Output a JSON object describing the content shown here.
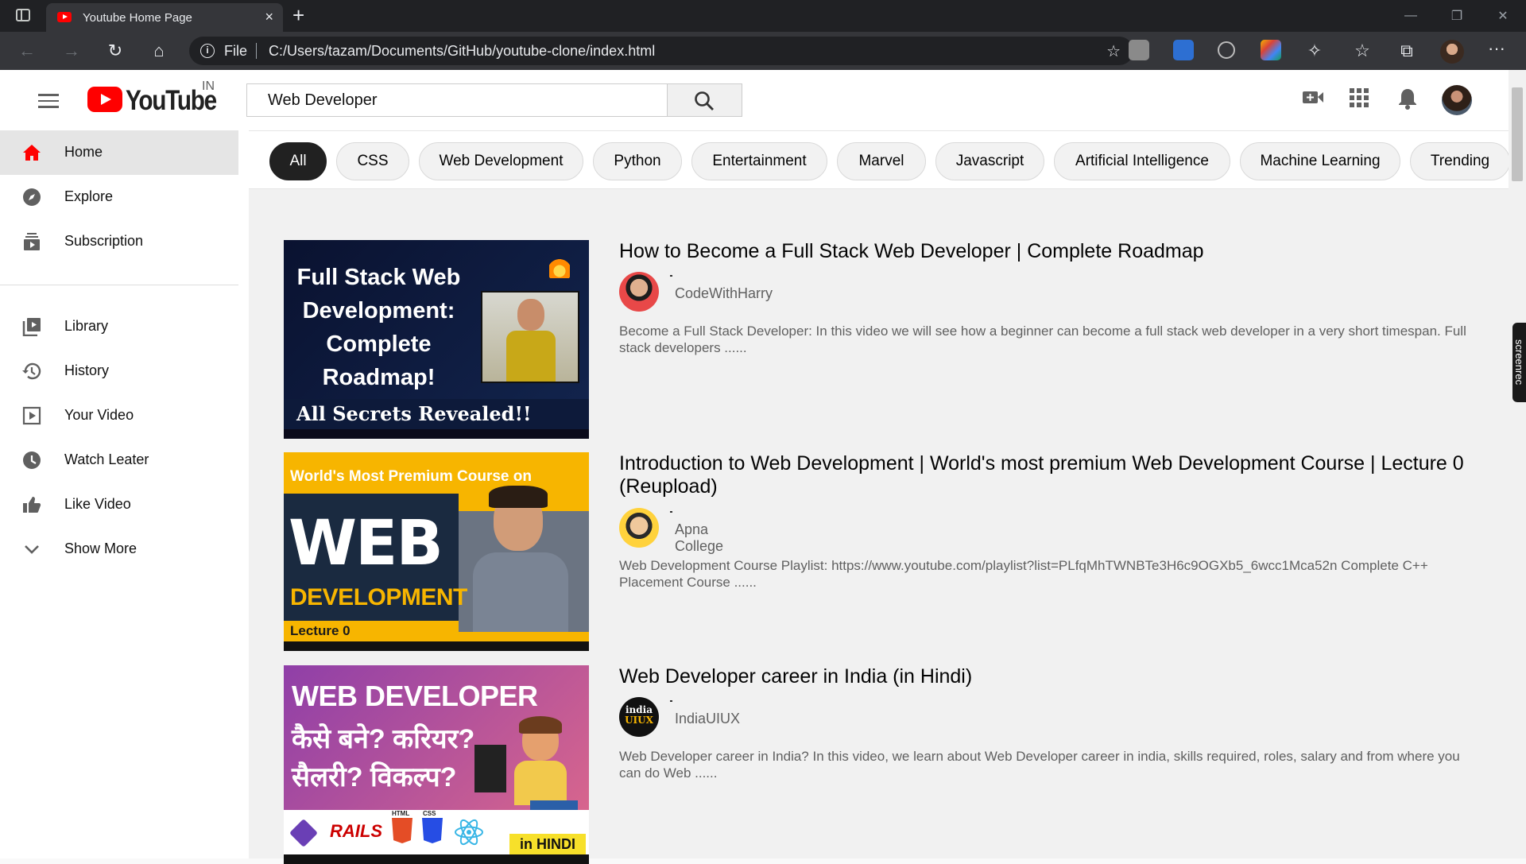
{
  "browser": {
    "tab_title": "Youtube Home Page",
    "close_tab": "×",
    "new_tab": "+",
    "address_scheme": "File",
    "address_url": "C:/Users/tazam/Documents/GitHub/youtube-clone/index.html",
    "min": "—",
    "max": "❐",
    "close": "✕",
    "more": "···"
  },
  "header": {
    "logo_text": "YouTube",
    "country_code": "IN",
    "search_value": "Web Developer"
  },
  "sidebar": {
    "items": [
      {
        "label": "Home",
        "icon": "home-icon"
      },
      {
        "label": "Explore",
        "icon": "compass-icon"
      },
      {
        "label": "Subscription",
        "icon": "subscriptions-icon"
      },
      {
        "label": "Library",
        "icon": "library-icon"
      },
      {
        "label": "History",
        "icon": "history-icon"
      },
      {
        "label": "Your Video",
        "icon": "play-icon"
      },
      {
        "label": "Watch Leater",
        "icon": "clock-icon"
      },
      {
        "label": "Like Video",
        "icon": "thumbs-up-icon"
      },
      {
        "label": "Show More",
        "icon": "chevron-down-icon"
      }
    ]
  },
  "chips": [
    "All",
    "CSS",
    "Web Development",
    "Python",
    "Entertainment",
    "Marvel",
    "Javascript",
    "Artificial Intelligence",
    "Machine Learning",
    "Trending"
  ],
  "videos": [
    {
      "title": "How to Become a Full Stack Web Developer | Complete Roadmap",
      "channel": "CodeWithHarry",
      "description": "Become a Full Stack Developer: In this video we will see how a beginner can become a full stack web developer in a very short timespan. Full stack developers ......",
      "thumb_lines": [
        "Full Stack Web",
        "Development:",
        "Complete",
        "Roadmap!"
      ],
      "thumb_banner": "All Secrets Revealed!!"
    },
    {
      "title": "Introduction to Web Development | World's most premium Web Development Course | Lecture 0 (Reupload)",
      "channel": "Apna College",
      "description": "Web Development Course Playlist: https://www.youtube.com/playlist?list=PLfqMhTWNBTe3H6c9OGXb5_6wcc1Mca52n Complete C++ Placement Course ......",
      "thumb_top": "World's Most Premium Course on",
      "thumb_big": "WEB",
      "thumb_sub": "DEVELOPMENT",
      "thumb_lecture": "Lecture 0"
    },
    {
      "title": "Web Developer career in India (in Hindi)",
      "channel": "IndiaUIUX",
      "channel_logo_top": "india",
      "channel_logo_bottom": "UIUX",
      "description": "Web Developer career in India? In this video, we learn about Web Developer career in india, skills required, roles, salary and from where you can do Web ......",
      "thumb_head": "WEB DEVELOPER",
      "thumb_l1": "कैसे बने? करियर?",
      "thumb_l2": "सैलरी? विकल्प?",
      "thumb_rails": "RAILS",
      "thumb_html": "HTML",
      "thumb_css": "CSS",
      "thumb_tag": "in HINDI"
    }
  ],
  "overlay": {
    "screenrec": "screenrec"
  },
  "colors": {
    "brand_red": "#ff0000",
    "chip_selected": "#212121",
    "main_bg": "#f1f1f1"
  }
}
